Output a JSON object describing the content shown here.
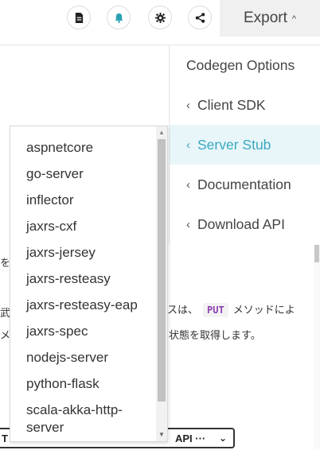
{
  "toolbar": {
    "icons": [
      "document-icon",
      "bell-icon",
      "gear-icon",
      "share-icon"
    ],
    "export_label": "Export"
  },
  "export_menu": {
    "heading": "Codegen Options",
    "items": [
      {
        "label": "Client SDK",
        "active": false
      },
      {
        "label": "Server Stub",
        "active": true
      },
      {
        "label": "Documentation",
        "active": false
      },
      {
        "label": "Download API",
        "active": false
      }
    ],
    "active_color": "#3aa7bf"
  },
  "background": {
    "line1_partial": "を",
    "line2_left": "武",
    "line2_mid": "スは、",
    "line2_code": "PUT",
    "line2_right": "メソッドによ",
    "line3_left": "メ",
    "line3_right": "状態を取得します。",
    "select_left": "T",
    "select_value": "API ···"
  },
  "server_options": [
    "aspnetcore",
    "go-server",
    "inflector",
    "jaxrs-cxf",
    "jaxrs-jersey",
    "jaxrs-resteasy",
    "jaxrs-resteasy-eap",
    "jaxrs-spec",
    "nodejs-server",
    "python-flask",
    "scala-akka-http-server"
  ]
}
